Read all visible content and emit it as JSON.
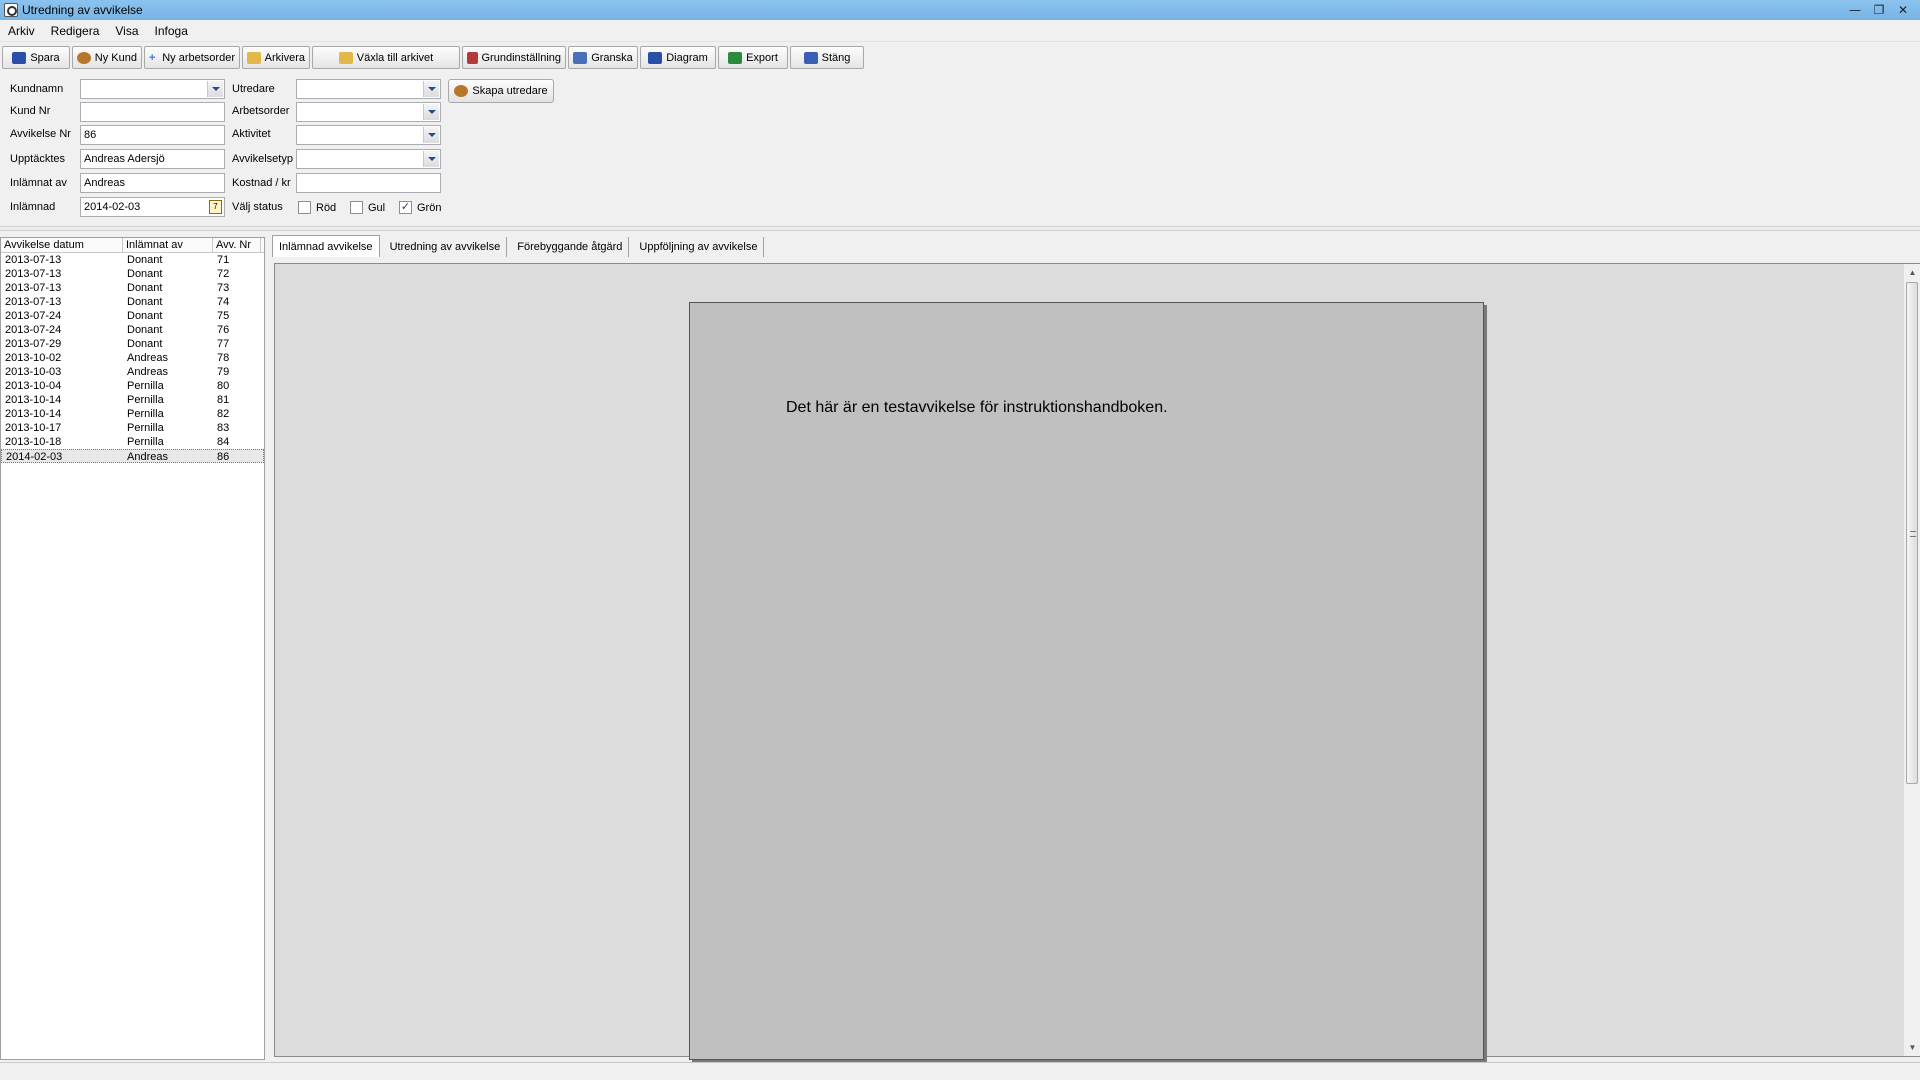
{
  "window": {
    "title": "Utredning av avvikelse",
    "minimize": "—",
    "restore": "❐",
    "close": "✕"
  },
  "menu": [
    "Arkiv",
    "Redigera",
    "Visa",
    "Infoga"
  ],
  "toolbar": [
    {
      "label": "Spara",
      "icon": "save-icon",
      "color": "#2a4fa8"
    },
    {
      "label": "Ny Kund",
      "icon": "users-icon",
      "color": "#b7762a"
    },
    {
      "label": "Ny arbetsorder",
      "icon": "plus-icon",
      "color": "#3a7fd5"
    },
    {
      "label": "Arkivera",
      "icon": "folder-icon",
      "color": "#e2b84a"
    },
    {
      "label": "Växla till arkivet",
      "icon": "folder-open-icon",
      "color": "#e2b84a"
    },
    {
      "label": "Grundinställning",
      "icon": "settings-icon",
      "color": "#b43a3a"
    },
    {
      "label": "Granska",
      "icon": "document-icon",
      "color": "#4a6fb8"
    },
    {
      "label": "Diagram",
      "icon": "chart-icon",
      "color": "#2a4fa8"
    },
    {
      "label": "Export",
      "icon": "excel-icon",
      "color": "#2b8a3e"
    },
    {
      "label": "Stäng",
      "icon": "door-icon",
      "color": "#3a5fb8"
    }
  ],
  "form": {
    "kundnamn": {
      "label": "Kundnamn",
      "value": ""
    },
    "kund_nr": {
      "label": "Kund Nr",
      "value": ""
    },
    "avvikelse_nr": {
      "label": "Avvikelse Nr",
      "value": "86"
    },
    "upptacktes": {
      "label": "Upptäcktes",
      "value": "Andreas Adersjö"
    },
    "inlamnat_av": {
      "label": "Inlämnat av",
      "value": "Andreas"
    },
    "inlamnad": {
      "label": "Inlämnad",
      "value": "2014-02-03",
      "cal": "7"
    },
    "utredare": {
      "label": "Utredare",
      "value": ""
    },
    "arbetsorder": {
      "label": "Arbetsorder",
      "value": ""
    },
    "aktivitet": {
      "label": "Aktivitet",
      "value": ""
    },
    "avvikelsetyp": {
      "label": "Avvikelsetyp",
      "value": ""
    },
    "kostnad": {
      "label": "Kostnad / kr",
      "value": ""
    },
    "status": {
      "label": "Välj status",
      "options": [
        {
          "label": "Röd",
          "checked": false
        },
        {
          "label": "Gul",
          "checked": false
        },
        {
          "label": "Grön",
          "checked": true
        }
      ],
      "check_mark": "✓"
    },
    "skapa_button": "Skapa utredare"
  },
  "list": {
    "headers": [
      "Avvikelse datum",
      "Inlämnat av",
      "Avv. Nr"
    ],
    "rows": [
      [
        "2013-07-13",
        "Donant",
        "71"
      ],
      [
        "2013-07-13",
        "Donant",
        "72"
      ],
      [
        "2013-07-13",
        "Donant",
        "73"
      ],
      [
        "2013-07-13",
        "Donant",
        "74"
      ],
      [
        "2013-07-24",
        "Donant",
        "75"
      ],
      [
        "2013-07-24",
        "Donant",
        "76"
      ],
      [
        "2013-07-29",
        "Donant",
        "77"
      ],
      [
        "2013-10-02",
        "Andreas",
        "78"
      ],
      [
        "2013-10-03",
        "Andreas",
        "79"
      ],
      [
        "2013-10-04",
        "Pernilla",
        "80"
      ],
      [
        "2013-10-14",
        "Pernilla",
        "81"
      ],
      [
        "2013-10-14",
        "Pernilla",
        "82"
      ],
      [
        "2013-10-17",
        "Pernilla",
        "83"
      ],
      [
        "2013-10-18",
        "Pernilla",
        "84"
      ],
      [
        "2014-02-03",
        "Andreas",
        "86"
      ]
    ],
    "selected_index": 14
  },
  "tabs": [
    {
      "label": "Inlämnad avvikelse",
      "active": true
    },
    {
      "label": "Utredning av avvikelse",
      "active": false
    },
    {
      "label": "Förebyggande åtgärd",
      "active": false
    },
    {
      "label": "Uppföljning av avvikelse",
      "active": false
    }
  ],
  "document": {
    "text": "Det här är en testavvikelse för instruktionshandboken."
  },
  "scroll": {
    "up": "▲",
    "down": "▼"
  }
}
